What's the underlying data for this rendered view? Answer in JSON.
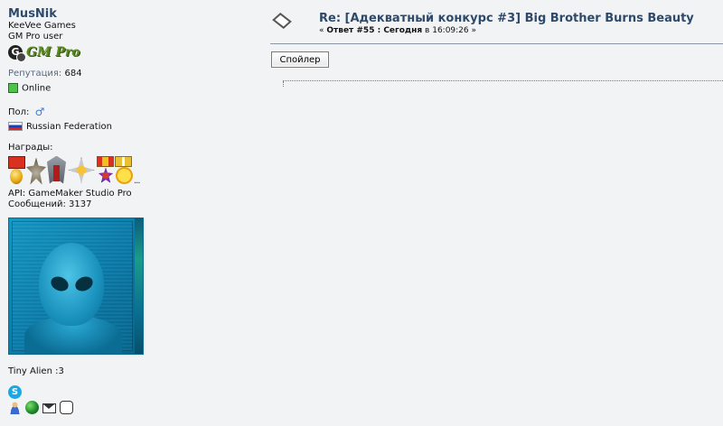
{
  "profile": {
    "username": "MusNik",
    "team": "KeeVee Games",
    "group": "GM Pro user",
    "group_badge": "GM Pro",
    "group_badge_icon": "G",
    "reputation_label": "Репутация:",
    "reputation_value": "684",
    "status": "Online",
    "gender_label": "Пол:",
    "gender_symbol": "♂",
    "country": "Russian Federation",
    "awards_label": "Награды:",
    "awards_more": "...",
    "api": "API: GameMaker Studio Pro",
    "posts": "Сообщений: 3137",
    "avatar_caption": "Tiny Alien :3",
    "skype_glyph": "S"
  },
  "post": {
    "subject": "Re: [Адекватный конкурс #3] Big Brother Burns Beauty",
    "meta_open": "« ",
    "reply_label": "Ответ #55 : Сегодня",
    "meta_mid": " в 16:09:26 ",
    "meta_close": "»",
    "spoiler_button": "Спойлер"
  },
  "colors": {
    "username": "#2e4a6b",
    "label": "#5a6a80",
    "online_green": "#4bc44b",
    "avatar_blue": "#1598c4"
  },
  "icons": [
    "message-icon",
    "gm-pro-badge-icon",
    "online-status-icon",
    "male-gender-icon",
    "russia-flag-icon",
    "skype-icon",
    "profile-icon",
    "website-icon",
    "email-icon",
    "personal-message-icon"
  ]
}
